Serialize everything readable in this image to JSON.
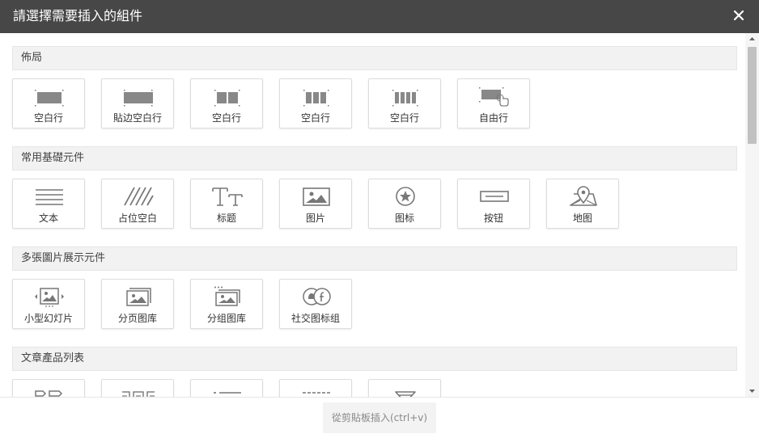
{
  "dialog": {
    "title": "請選擇需要插入的組件",
    "close_label": "×"
  },
  "sections": [
    {
      "title": "佈局",
      "items": [
        {
          "label": "空白行",
          "icon": "single-row-icon"
        },
        {
          "label": "貼边空白行",
          "icon": "edge-row-icon"
        },
        {
          "label": "空白行",
          "icon": "two-column-row-icon"
        },
        {
          "label": "空白行",
          "icon": "three-column-row-icon"
        },
        {
          "label": "空白行",
          "icon": "four-column-row-icon"
        },
        {
          "label": "自由行",
          "icon": "free-row-icon"
        }
      ]
    },
    {
      "title": "常用基礎元件",
      "items": [
        {
          "label": "文本",
          "icon": "text-icon"
        },
        {
          "label": "占位空白",
          "icon": "placeholder-icon"
        },
        {
          "label": "标题",
          "icon": "heading-icon"
        },
        {
          "label": "图片",
          "icon": "image-icon"
        },
        {
          "label": "图标",
          "icon": "star-icon"
        },
        {
          "label": "按钮",
          "icon": "button-icon"
        },
        {
          "label": "地图",
          "icon": "map-icon"
        }
      ]
    },
    {
      "title": "多張圖片展示元件",
      "items": [
        {
          "label": "小型幻灯片",
          "icon": "slideshow-icon"
        },
        {
          "label": "分页图库",
          "icon": "paged-gallery-icon"
        },
        {
          "label": "分组图库",
          "icon": "grouped-gallery-icon"
        },
        {
          "label": "社交图标组",
          "icon": "social-icons-icon"
        }
      ]
    },
    {
      "title": "文章產品列表",
      "items": [
        {
          "label": "",
          "icon": "tag-list-icon"
        },
        {
          "label": "",
          "icon": "carousel-list-icon"
        },
        {
          "label": "",
          "icon": "bullet-list-icon"
        },
        {
          "label": "",
          "icon": "dashed-list-icon"
        },
        {
          "label": "",
          "icon": "filter-icon"
        }
      ]
    }
  ],
  "footer": {
    "paste_label": "從剪貼板插入(ctrl+v)"
  },
  "colors": {
    "titlebar_bg": "#474747",
    "section_bg": "#f2f2f2",
    "icon_gray": "#888888"
  }
}
